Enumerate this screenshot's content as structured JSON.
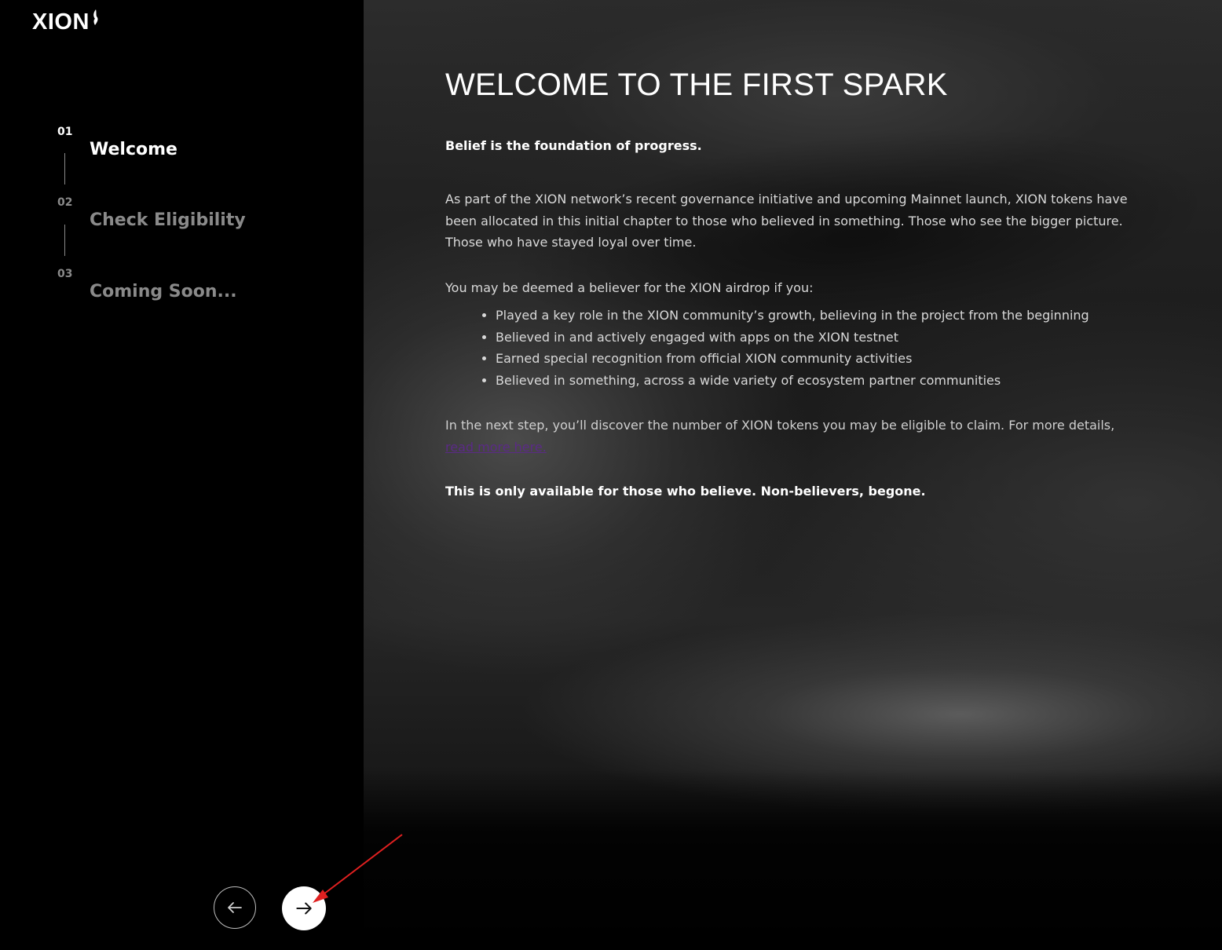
{
  "brand": {
    "logo_text": "XION"
  },
  "sidebar": {
    "steps": [
      {
        "number": "01",
        "label": "Welcome",
        "active": true
      },
      {
        "number": "02",
        "label": "Check Eligibility",
        "active": false
      },
      {
        "number": "03",
        "label": "Coming Soon...",
        "active": false
      }
    ]
  },
  "main": {
    "title": "WELCOME TO THE FIRST SPARK",
    "lead": "Belief is the foundation of progress.",
    "paragraph1": "As part of the XION network’s recent governance initiative and upcoming Mainnet launch, XION tokens have been allocated in this initial chapter to those who believed in something. Those who see the bigger picture. Those who have stayed loyal over time.",
    "paragraph2": "You may be deemed a believer for the XION airdrop if you:",
    "criteria": [
      "Played a key role in the XION community’s growth, believing in the project from the beginning",
      "Believed in and actively engaged with apps on the XION testnet",
      "Earned special recognition from official XION community activities",
      "Believed in something, across a wide variety of ecosystem partner communities"
    ],
    "paragraph3": "In the next step, you’ll discover the number of XION tokens you may be eligible to claim. For more details,",
    "read_more_link": "read more here.",
    "closing": "This is only available for those who believe. Non-believers, begone."
  },
  "navigation": {
    "prev_icon": "arrow-left-icon",
    "next_icon": "arrow-right-icon"
  },
  "colors": {
    "sidebar_bg": "#000000",
    "active_text": "#ffffff",
    "inactive_text": "#8a8a8a",
    "link": "#5b2a86",
    "annotation": "#e02020"
  }
}
